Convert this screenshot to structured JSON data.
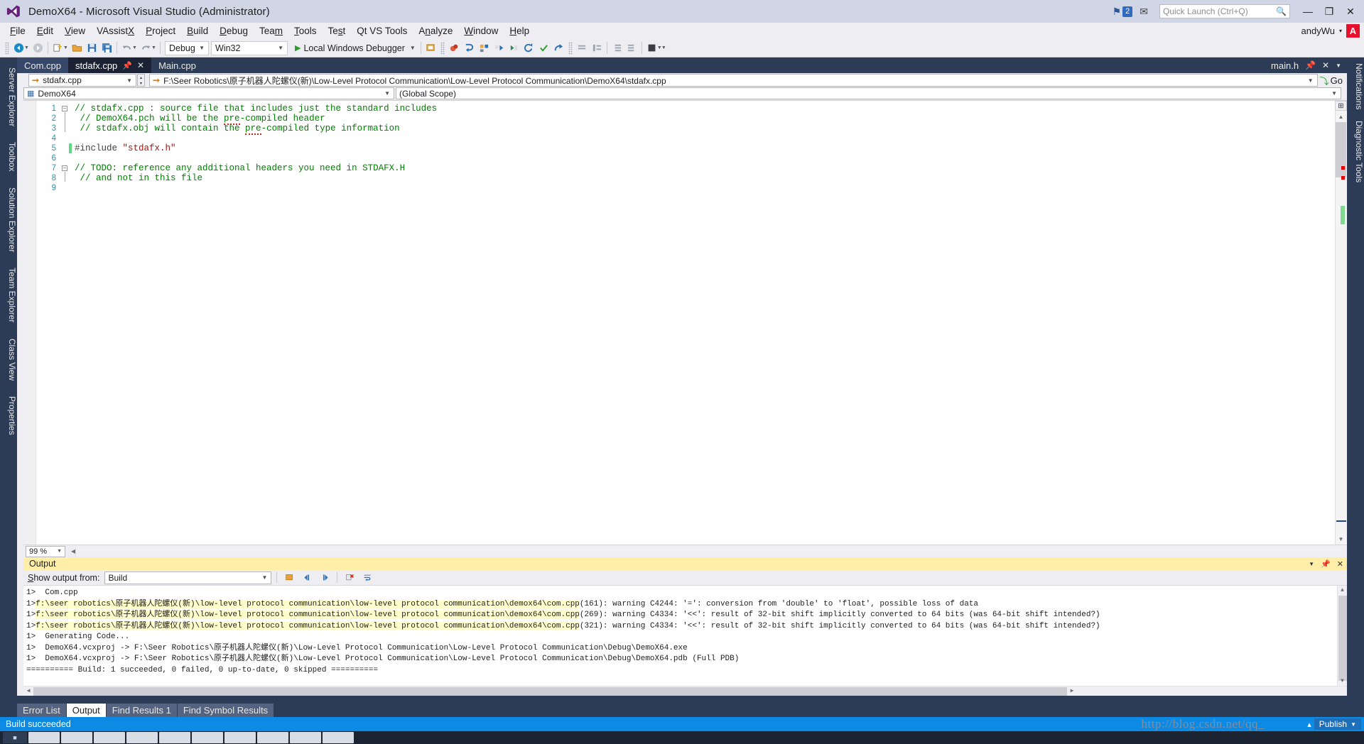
{
  "titlebar": {
    "app_title": "DemoX64 - Microsoft Visual Studio (Administrator)",
    "logo_icon": "visual-studio-logo-icon",
    "notification_flag_icon": "flag-icon",
    "notification_count": "2",
    "feedback_icon": "feedback-icon",
    "quick_launch_placeholder": "Quick Launch (Ctrl+Q)",
    "quick_launch_value": "",
    "search_icon": "search-icon",
    "minimize_label": "—",
    "restore_label": "❐",
    "close_label": "✕"
  },
  "menubar": {
    "items": [
      {
        "label": "File",
        "accel": "F"
      },
      {
        "label": "Edit",
        "accel": "E"
      },
      {
        "label": "View",
        "accel": "V"
      },
      {
        "label": "VAssistX",
        "accel": "X"
      },
      {
        "label": "Project",
        "accel": "P"
      },
      {
        "label": "Build",
        "accel": "B"
      },
      {
        "label": "Debug",
        "accel": "D"
      },
      {
        "label": "Team",
        "accel": "m"
      },
      {
        "label": "Tools",
        "accel": "T"
      },
      {
        "label": "Test",
        "accel": "s"
      },
      {
        "label": "Qt VS Tools",
        "accel": ""
      },
      {
        "label": "Analyze",
        "accel": "n"
      },
      {
        "label": "Window",
        "accel": "W"
      },
      {
        "label": "Help",
        "accel": "H"
      }
    ],
    "user_name": "andyWu",
    "user_caret": "▾",
    "user_avatar_letter": "A"
  },
  "toolbar": {
    "navigate_back_icon": "navigate-back-icon",
    "navigate_forward_icon": "navigate-forward-icon",
    "new_project_icon": "new-project-icon",
    "open_file_icon": "open-file-icon",
    "save_icon": "save-icon",
    "save_all_icon": "save-all-icon",
    "undo_icon": "undo-icon",
    "redo_icon": "redo-icon",
    "config_value": "Debug",
    "platform_value": "Win32",
    "run_label": "Local Windows Debugger",
    "run_icon": "play-triangle-icon",
    "attach_icon": "attach-process-icon",
    "breakpoint_icon": "breakpoint-icon",
    "step_into_icon": "step-into-icon",
    "step_over_icon": "step-over-icon",
    "step_out_icon": "step-out-icon",
    "check_icon": "check-icon",
    "goto_icon": "goto-icon",
    "comment_icon": "comment-icon",
    "uncomment_icon": "uncomment-icon",
    "indent_icon": "indent-icon",
    "outdent_icon": "outdent-icon",
    "stop_icon": "stop-icon"
  },
  "document_tabs": {
    "tabs": [
      {
        "label": "Com.cpp",
        "state": "inactive",
        "pin": false,
        "close": false
      },
      {
        "label": "stdafx.cpp",
        "state": "active",
        "pin": true,
        "close": true
      },
      {
        "label": "Main.cpp",
        "state": "plain",
        "pin": false,
        "close": false
      }
    ],
    "pin_icon": "pin-icon",
    "close_icon": "close-icon",
    "right_label": "main.h",
    "right_pin_icon": "pin-icon",
    "right_close_icon": "close-icon",
    "right_dropdown_icon": "chevron-down-icon"
  },
  "navbar": {
    "file_combo_value": "stdafx.cpp",
    "file_combo_icon": "arrow-right-icon",
    "path_value": "F:\\Seer Robotics\\原子机器人陀螺仪(新)\\Low-Level Protocol Communication\\Low-Level Protocol Communication\\DemoX64\\stdafx.cpp",
    "path_icon": "arrow-right-icon",
    "go_label": "Go",
    "go_icon": "go-arrow-icon",
    "spinner_up": "▴",
    "spinner_down": "▾",
    "dropdown_icon": "chevron-down-icon"
  },
  "scopebar": {
    "left_value": "DemoX64",
    "left_icon": "project-icon",
    "right_value": "(Global Scope)",
    "dropdown_icon": "chevron-down-icon"
  },
  "editor": {
    "zoom_value": "99 %",
    "zoom_dropdown_icon": "chevron-down-icon",
    "split_icon": "split-view-icon",
    "scroll_up_icon": "scroll-up-icon",
    "scroll_down_icon": "scroll-down-icon",
    "lines": [
      {
        "num": "1",
        "fold": "box",
        "change": "none",
        "segments": [
          {
            "text": "// stdafx.cpp : source file that includes just the standard includes",
            "cls": "c-comment"
          }
        ]
      },
      {
        "num": "2",
        "fold": "bar",
        "change": "none",
        "segments": [
          {
            "text": " // DemoX64.pch will be the ",
            "cls": "c-comment"
          },
          {
            "text": "pre",
            "cls": "c-comment squiggle"
          },
          {
            "text": "-compiled header",
            "cls": "c-comment"
          }
        ]
      },
      {
        "num": "3",
        "fold": "bar",
        "change": "none",
        "segments": [
          {
            "text": " // stdafx.obj will contain the ",
            "cls": "c-comment"
          },
          {
            "text": "pre",
            "cls": "c-comment squiggle"
          },
          {
            "text": "-compiled type information",
            "cls": "c-comment"
          }
        ]
      },
      {
        "num": "4",
        "fold": "none",
        "change": "none",
        "segments": []
      },
      {
        "num": "5",
        "fold": "none",
        "change": "green",
        "segments": [
          {
            "text": "#include ",
            "cls": "c-pp"
          },
          {
            "text": "\"stdafx.h\"",
            "cls": "c-str"
          }
        ]
      },
      {
        "num": "6",
        "fold": "none",
        "change": "none",
        "segments": []
      },
      {
        "num": "7",
        "fold": "box",
        "change": "none",
        "segments": [
          {
            "text": "// TODO: reference any additional headers you need in STDAFX.H",
            "cls": "c-comment"
          }
        ]
      },
      {
        "num": "8",
        "fold": "bar",
        "change": "none",
        "segments": [
          {
            "text": " // and not in this file",
            "cls": "c-comment"
          }
        ]
      },
      {
        "num": "9",
        "fold": "none",
        "change": "none",
        "segments": []
      }
    ]
  },
  "output": {
    "title": "Output",
    "dropdown_icon": "chevron-down-icon",
    "pin_icon": "pin-icon",
    "close_icon": "close-icon",
    "source_label": "Show output from:",
    "source_value": "Build",
    "find_message_icon": "find-message-icon",
    "go_to_previous_icon": "go-to-previous-icon",
    "go_to_next_icon": "go-to-next-icon",
    "clear_all_icon": "clear-all-icon",
    "toggle_word_wrap_icon": "toggle-word-wrap-icon",
    "lines": [
      {
        "prefix": "1>",
        "text": "  Com.cpp",
        "highlight": false
      },
      {
        "prefix": "1>",
        "text": "f:\\seer robotics\\原子机器人陀螺仪(新)\\low-level protocol communication\\low-level protocol communication\\demox64\\com.cpp",
        "suffix": "(161): warning C4244: '=': conversion from 'double' to 'float', possible loss of data",
        "highlight": true
      },
      {
        "prefix": "1>",
        "text": "f:\\seer robotics\\原子机器人陀螺仪(新)\\low-level protocol communication\\low-level protocol communication\\demox64\\com.cpp",
        "suffix": "(269): warning C4334: '<<': result of 32-bit shift implicitly converted to 64 bits (was 64-bit shift intended?)",
        "highlight": true
      },
      {
        "prefix": "1>",
        "text": "f:\\seer robotics\\原子机器人陀螺仪(新)\\low-level protocol communication\\low-level protocol communication\\demox64\\com.cpp",
        "suffix": "(321): warning C4334: '<<': result of 32-bit shift implicitly converted to 64 bits (was 64-bit shift intended?)",
        "highlight": true
      },
      {
        "prefix": "1>",
        "text": "  Generating Code...",
        "highlight": false
      },
      {
        "prefix": "1>",
        "text": "  DemoX64.vcxproj -> F:\\Seer Robotics\\原子机器人陀螺仪(新)\\Low-Level Protocol Communication\\Low-Level Protocol Communication\\Debug\\DemoX64.exe",
        "highlight": false
      },
      {
        "prefix": "1>",
        "text": "  DemoX64.vcxproj -> F:\\Seer Robotics\\原子机器人陀螺仪(新)\\Low-Level Protocol Communication\\Low-Level Protocol Communication\\Debug\\DemoX64.pdb (Full PDB)",
        "highlight": false
      },
      {
        "prefix": "",
        "text": "========== Build: 1 succeeded, 0 failed, 0 up-to-date, 0 skipped ==========",
        "highlight": false
      }
    ]
  },
  "bottom_tabs": {
    "tabs": [
      {
        "label": "Error List",
        "active": false
      },
      {
        "label": "Output",
        "active": true
      },
      {
        "label": "Find Results 1",
        "active": false
      },
      {
        "label": "Find Symbol Results",
        "active": false
      }
    ]
  },
  "left_rail": {
    "items": [
      {
        "label": "Server Explorer"
      },
      {
        "label": "Toolbox"
      },
      {
        "label": "Solution Explorer"
      },
      {
        "label": "Team Explorer"
      },
      {
        "label": "Class View"
      },
      {
        "label": "Properties"
      }
    ]
  },
  "right_rail": {
    "items": [
      {
        "label": "Notifications"
      },
      {
        "label": "Diagnostic Tools"
      }
    ]
  },
  "statusbar": {
    "message": "Build succeeded",
    "publish_label": "Publish",
    "publish_icon": "publish-up-arrow-icon",
    "publish_caret": "▴",
    "watermark": "http://blog.csdn.net/qq_"
  }
}
